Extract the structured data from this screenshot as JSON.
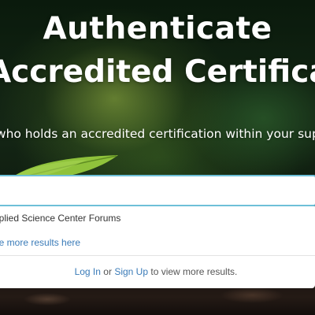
{
  "hero": {
    "title_line_1": "Authenticate",
    "title_line_2": "Accredited Certification",
    "subtitle": "Verify who holds an accredited certification within your supply chain"
  },
  "search": {
    "value": "",
    "placeholder": ""
  },
  "results": {
    "items": [
      {
        "label": "Applied Science Center Forums"
      }
    ],
    "more_results_link": "See more results here",
    "login_link": "Log In",
    "connector": "or",
    "signup_link": "Sign Up",
    "login_suffix": "to view more results."
  },
  "colors": {
    "link": "#3a7bb8",
    "input_border": "#6ec0d8",
    "title_text": "#ffffff"
  }
}
